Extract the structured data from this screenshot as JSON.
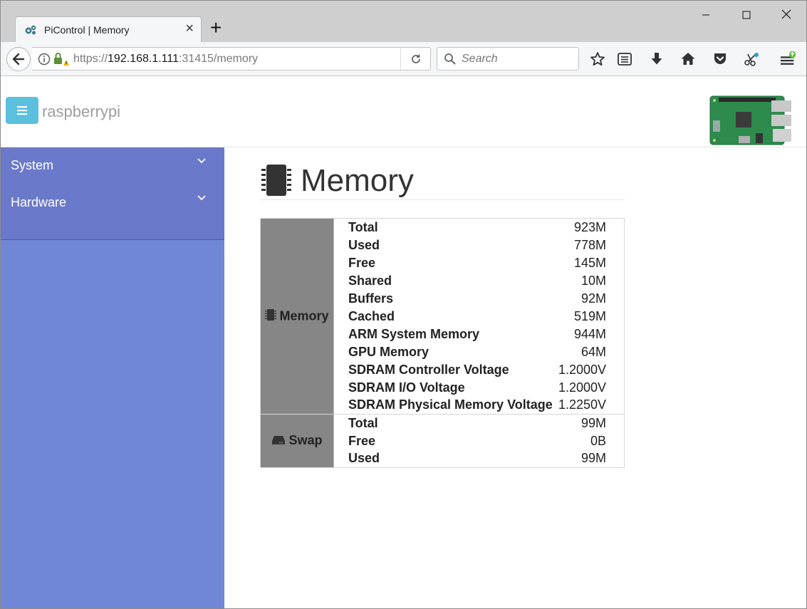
{
  "browser": {
    "tab_title": "PiControl | Memory",
    "url_prefix": "https://",
    "url_host": "192.168.1.111",
    "url_rest": ":31415/memory",
    "search_placeholder": "Search"
  },
  "header": {
    "brand": "raspberrypi"
  },
  "sidebar": {
    "items": [
      {
        "label": "System"
      },
      {
        "label": "Hardware"
      }
    ]
  },
  "main": {
    "title": "Memory",
    "memory_group": "Memory",
    "swap_group": "Swap",
    "memory_rows": [
      {
        "key": "Total",
        "value": "923M"
      },
      {
        "key": "Used",
        "value": "778M"
      },
      {
        "key": "Free",
        "value": "145M"
      },
      {
        "key": "Shared",
        "value": "10M"
      },
      {
        "key": "Buffers",
        "value": "92M"
      },
      {
        "key": "Cached",
        "value": "519M"
      },
      {
        "key": "ARM System Memory",
        "value": "944M"
      },
      {
        "key": "GPU Memory",
        "value": "64M"
      },
      {
        "key": "SDRAM Controller Voltage",
        "value": "1.2000V"
      },
      {
        "key": "SDRAM I/O Voltage",
        "value": "1.2000V"
      },
      {
        "key": "SDRAM Physical Memory Voltage",
        "value": "1.2250V"
      }
    ],
    "swap_rows": [
      {
        "key": "Total",
        "value": "99M"
      },
      {
        "key": "Free",
        "value": "0B"
      },
      {
        "key": "Used",
        "value": "99M"
      }
    ]
  },
  "icons": {
    "sidebar_bg": "#7086d6",
    "sidebar_item_bg": "#6a79c9",
    "hamburger_bg": "#5bc0de",
    "group_cell_bg": "#868686"
  }
}
